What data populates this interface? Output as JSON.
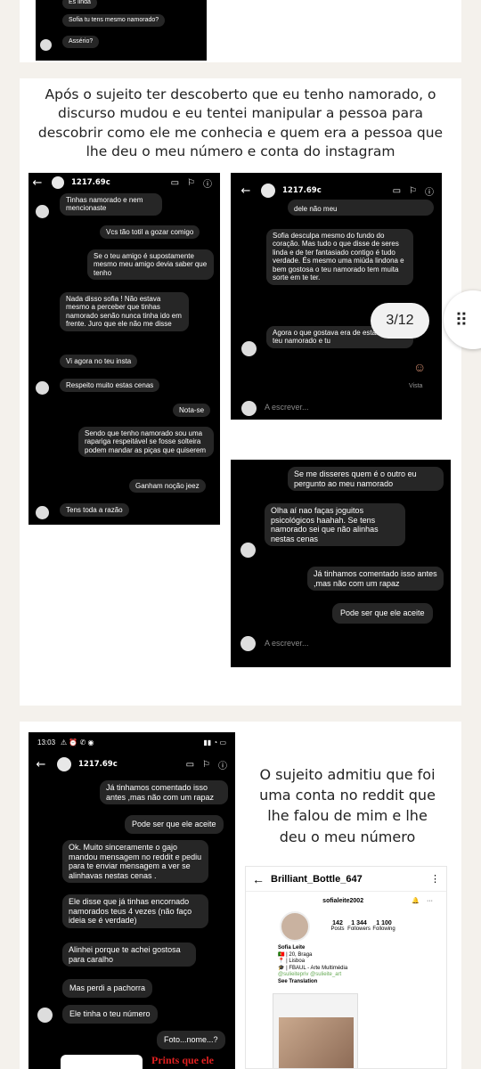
{
  "top_shot": {
    "lines": [
      "És linda",
      "Sofia tu tens mesmo namorado?",
      "Assério?"
    ]
  },
  "caption1": "Após o sujeito ter descoberto que eu tenho namorado, o discurso mudou e eu tentei manipular a pessoa para descobrir como ele me conhecia e quem era a pessoa que lhe deu o meu número e conta do instagram",
  "chatA": {
    "title": "1217.69c",
    "msgs": [
      "Tinhas namorado e nem mencionaste",
      "Vcs tão totil a gozar comigo",
      "Se o teu amigo é supostamente mesmo meu amigo devia saber que tenho",
      "Nada disso sofia ! Não estava mesmo a perceber que tinhas namorado senão nunca tinha ido em frente. Juro que ele não me disse",
      "Vi agora no teu insta",
      "Respeito muito estas cenas",
      "Nota-se",
      "Sendo que tenho namorado sou uma rapariga respeitável se fosse solteira podem mandar as piças que quiserem",
      "Ganham noção jeez",
      "Tens toda a razão"
    ]
  },
  "chatB": {
    "title": "1217.69c",
    "msgs": [
      "dele não meu",
      "Sofia desculpa mesmo do fundo do coração. Mas tudo o que disse de seres linda e de ter fantasiado contigo é tudo verdade. És mesmo uma miúda lindona e bem gostosa o teu namorado tem muita sorte em te ter.",
      "Agora o que gostava era de estar com o teu namorado e tu"
    ],
    "seen": "Vista",
    "input": "A escrever...",
    "counter": "3/12"
  },
  "chatC": {
    "msgs": [
      "Se me disseres quem é o outro eu pergunto ao meu namorado",
      "Olha aí nao faças joguitos psicológicos haahah. Se tens namorado sei que não alinhas nestas cenas",
      "Já tinhamos comentado isso antes ,mas não com um rapaz",
      "Pode ser que ele aceite"
    ],
    "input": "A escrever..."
  },
  "chatD": {
    "status_time": "13:03",
    "title": "1217.69c",
    "msgs": [
      "Já tinhamos comentado isso antes ,mas não com um rapaz",
      "Pode ser que ele aceite",
      "Ok. Muito sinceramente o gajo mandou mensagem no reddit e pediu para te enviar mensagem a ver se alinhavas nestas cenas .",
      "Ele disse que já tinhas encornado namorados teus 4 vezes (não faço ideia se é verdade)",
      "Alinhei porque te achei gostosa para caralho",
      "Mas perdi a pachorra",
      "Ele tinha o teu número",
      "Foto...nome...?"
    ],
    "footer": "Prints que ele"
  },
  "caption2": "O sujeito admitiu que foi uma conta no reddit que lhe falou de mim e lhe deu o meu número",
  "reddit": {
    "title": "Brilliant_Bottle_647",
    "handle": "sofialeite2002",
    "posts": "142",
    "posts_label": "Posts",
    "followers": "1 344",
    "followers_label": "Followers",
    "following": "1 100",
    "following_label": "Following",
    "name": "Sofia Leite",
    "bio": [
      "🇵🇹 | 20, Braga",
      "📍 | Lisboa",
      "🎓 | FBAUL - Arte Multimédia",
      "@sulieitepriv @sulieite_art"
    ],
    "see": "See Translation"
  }
}
